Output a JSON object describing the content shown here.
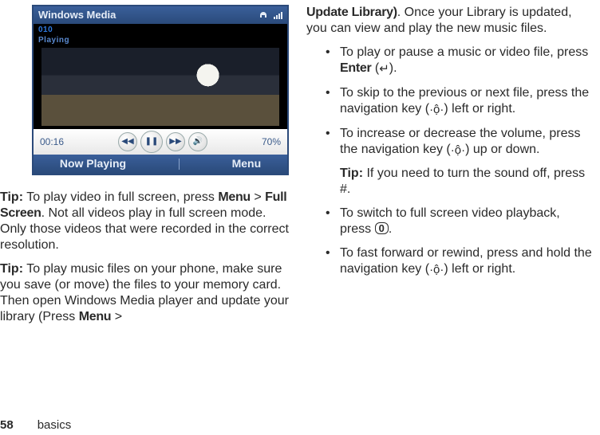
{
  "player": {
    "title": "Windows Media",
    "track_id": "010",
    "state": "Playing",
    "elapsed": "00:16",
    "volume_pct": "70%",
    "soft_left": "Now Playing",
    "soft_right": "Menu"
  },
  "left": {
    "tip1_lead": "Tip:",
    "tip1_a": " To play video in full screen, press ",
    "tip1_menu": "Menu",
    "tip1_gt": " > ",
    "tip1_fs": "Full Screen",
    "tip1_rest": ". Not all videos play in full screen mode. Only those videos that were recorded in the correct resolution.",
    "tip2_lead": "Tip:",
    "tip2_a": " To play music files on your phone, make sure you save (or move) the files to your memory card. Then open Windows Media player and update your library (Press ",
    "tip2_menu": "Menu",
    "tip2_gt": " >"
  },
  "right": {
    "cont_ul": "Update Library)",
    "cont_rest": ". Once your Library is updated, you can view and play the new music files.",
    "items": [
      {
        "a": "To play or pause a music or video file, press ",
        "b": "Enter",
        "c": " (",
        "glyph": "↵",
        "d": ")."
      },
      {
        "a": "To skip to the previous or next file, press the navigation key (",
        "glyph": "·ộ·",
        "d": ") left or right."
      },
      {
        "a": "To increase or decrease the volume, press the navigation key (",
        "glyph": "·ộ·",
        "d": ") up or down."
      }
    ],
    "tip3_lead": "Tip:",
    "tip3_rest": " If you need to turn the sound off, press #.",
    "item4_a": "To switch to full screen video playback, press ",
    "item4_key": "0",
    "item4_b": ".",
    "item5_a": "To fast forward or rewind, press and hold the navigation key (",
    "item5_glyph": "·ộ·",
    "item5_b": ") left or right."
  },
  "footer": {
    "page": "58",
    "section": "basics"
  }
}
